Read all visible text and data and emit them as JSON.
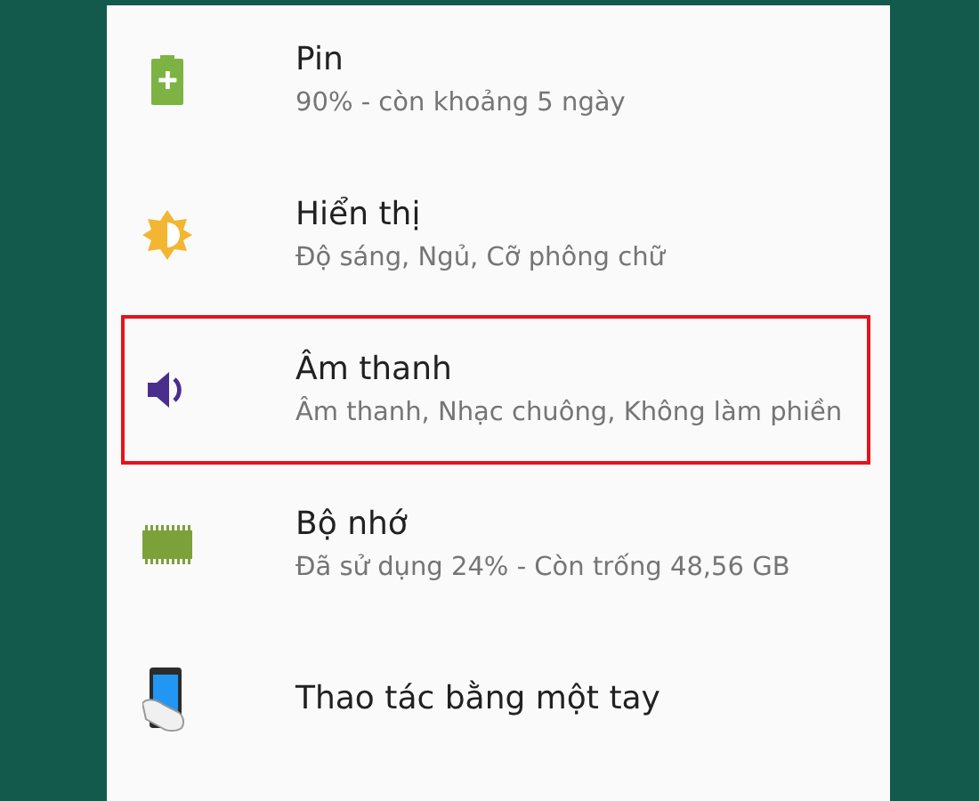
{
  "settings_items": [
    {
      "kind": "battery",
      "title": "Pin",
      "subtitle": "90% - còn khoảng 5 ngày",
      "highlighted": false
    },
    {
      "kind": "display",
      "title": "Hiển thị",
      "subtitle": "Độ sáng, Ngủ, Cỡ phông chữ",
      "highlighted": false
    },
    {
      "kind": "sound",
      "title": "Âm thanh",
      "subtitle": "Âm thanh, Nhạc chuông, Không làm phiền",
      "highlighted": true
    },
    {
      "kind": "storage",
      "title": "Bộ nhớ",
      "subtitle": "Đã sử dụng 24% - Còn trống 48,56 GB",
      "highlighted": false
    },
    {
      "kind": "onehand",
      "title": "Thao tác bằng một tay",
      "highlighted": false
    }
  ]
}
